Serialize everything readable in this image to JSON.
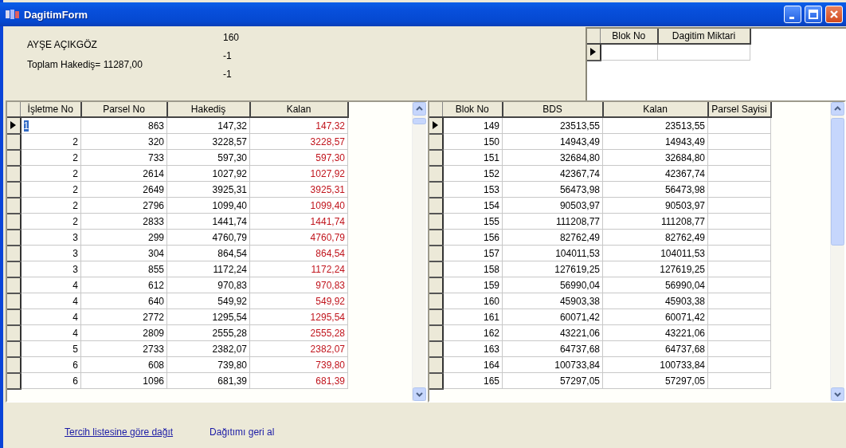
{
  "window": {
    "title": "DagitimForm"
  },
  "header": {
    "name": "AYŞE AÇIKGÖZ",
    "total": "Toplam Hakediş= 11287,00",
    "values": [
      "160",
      "-1",
      "-1"
    ]
  },
  "distribution_grid": {
    "columns": [
      "Blok No",
      "Dagitim Miktari"
    ],
    "rows": [
      {
        "selected": true
      }
    ]
  },
  "parcel_grid": {
    "columns": [
      "İşletme No",
      "Parsel No",
      "Hakediş",
      "Kalan"
    ],
    "rows": [
      {
        "cells": [
          "1",
          "863",
          "147,32",
          "147,32"
        ],
        "selected": true
      },
      {
        "cells": [
          "2",
          "320",
          "3228,57",
          "3228,57"
        ],
        "selected": false
      },
      {
        "cells": [
          "2",
          "733",
          "597,30",
          "597,30"
        ],
        "selected": false
      },
      {
        "cells": [
          "2",
          "2614",
          "1027,92",
          "1027,92"
        ],
        "selected": false
      },
      {
        "cells": [
          "2",
          "2649",
          "3925,31",
          "3925,31"
        ],
        "selected": false
      },
      {
        "cells": [
          "2",
          "2796",
          "1099,40",
          "1099,40"
        ],
        "selected": false
      },
      {
        "cells": [
          "2",
          "2833",
          "1441,74",
          "1441,74"
        ],
        "selected": false
      },
      {
        "cells": [
          "3",
          "299",
          "4760,79",
          "4760,79"
        ],
        "selected": false
      },
      {
        "cells": [
          "3",
          "304",
          "864,54",
          "864,54"
        ],
        "selected": false
      },
      {
        "cells": [
          "3",
          "855",
          "1172,24",
          "1172,24"
        ],
        "selected": false
      },
      {
        "cells": [
          "4",
          "612",
          "970,83",
          "970,83"
        ],
        "selected": false
      },
      {
        "cells": [
          "4",
          "640",
          "549,92",
          "549,92"
        ],
        "selected": false
      },
      {
        "cells": [
          "4",
          "2772",
          "1295,54",
          "1295,54"
        ],
        "selected": false
      },
      {
        "cells": [
          "4",
          "2809",
          "2555,28",
          "2555,28"
        ],
        "selected": false
      },
      {
        "cells": [
          "5",
          "2733",
          "2382,07",
          "2382,07"
        ],
        "selected": false
      },
      {
        "cells": [
          "6",
          "608",
          "739,80",
          "739,80"
        ],
        "selected": false
      },
      {
        "cells": [
          "6",
          "1096",
          "681,39",
          "681,39"
        ],
        "selected": false
      }
    ]
  },
  "block_grid": {
    "columns": [
      "Blok No",
      "BDS",
      "Kalan",
      "Parsel Sayisi"
    ],
    "rows": [
      {
        "cells": [
          "149",
          "23513,55",
          "23513,55"
        ],
        "selected": true
      },
      {
        "cells": [
          "150",
          "14943,49",
          "14943,49"
        ],
        "selected": false
      },
      {
        "cells": [
          "151",
          "32684,80",
          "32684,80"
        ],
        "selected": false
      },
      {
        "cells": [
          "152",
          "42367,74",
          "42367,74"
        ],
        "selected": false
      },
      {
        "cells": [
          "153",
          "56473,98",
          "56473,98"
        ],
        "selected": false
      },
      {
        "cells": [
          "154",
          "90503,97",
          "90503,97"
        ],
        "selected": false
      },
      {
        "cells": [
          "155",
          "111208,77",
          "111208,77"
        ],
        "selected": false
      },
      {
        "cells": [
          "156",
          "82762,49",
          "82762,49"
        ],
        "selected": false
      },
      {
        "cells": [
          "157",
          "104011,53",
          "104011,53"
        ],
        "selected": false
      },
      {
        "cells": [
          "158",
          "127619,25",
          "127619,25"
        ],
        "selected": false
      },
      {
        "cells": [
          "159",
          "56990,04",
          "56990,04"
        ],
        "selected": false
      },
      {
        "cells": [
          "160",
          "45903,38",
          "45903,38"
        ],
        "selected": false
      },
      {
        "cells": [
          "161",
          "60071,42",
          "60071,42"
        ],
        "selected": false
      },
      {
        "cells": [
          "162",
          "43221,06",
          "43221,06"
        ],
        "selected": false
      },
      {
        "cells": [
          "163",
          "64737,68",
          "64737,68"
        ],
        "selected": false
      },
      {
        "cells": [
          "164",
          "100733,84",
          "100733,84"
        ],
        "selected": false
      },
      {
        "cells": [
          "165",
          "57297,05",
          "57297,05"
        ],
        "selected": false
      }
    ]
  },
  "links": [
    {
      "label": "Tercih listesine göre dağıt",
      "underlined": true
    },
    {
      "label": "Dağıtımı geri al",
      "underlined": false
    }
  ]
}
